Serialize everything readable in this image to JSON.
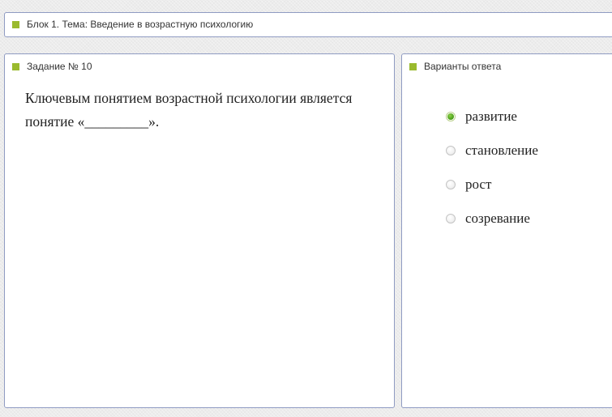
{
  "topic": {
    "title": "Блок 1. Тема: Введение в возрастную психологию"
  },
  "task": {
    "header": "Задание № 10",
    "question": "Ключевым понятием возрастной психологии является понятие «_________»."
  },
  "answers": {
    "header": "Варианты ответа",
    "options": [
      {
        "label": "развитие",
        "selected": true
      },
      {
        "label": "становление",
        "selected": false
      },
      {
        "label": "рост",
        "selected": false
      },
      {
        "label": "созревание",
        "selected": false
      }
    ]
  },
  "colors": {
    "accent_square": "#9aba2e",
    "panel_border": "#8f9bc2",
    "radio_selected": "#4ea31c"
  }
}
